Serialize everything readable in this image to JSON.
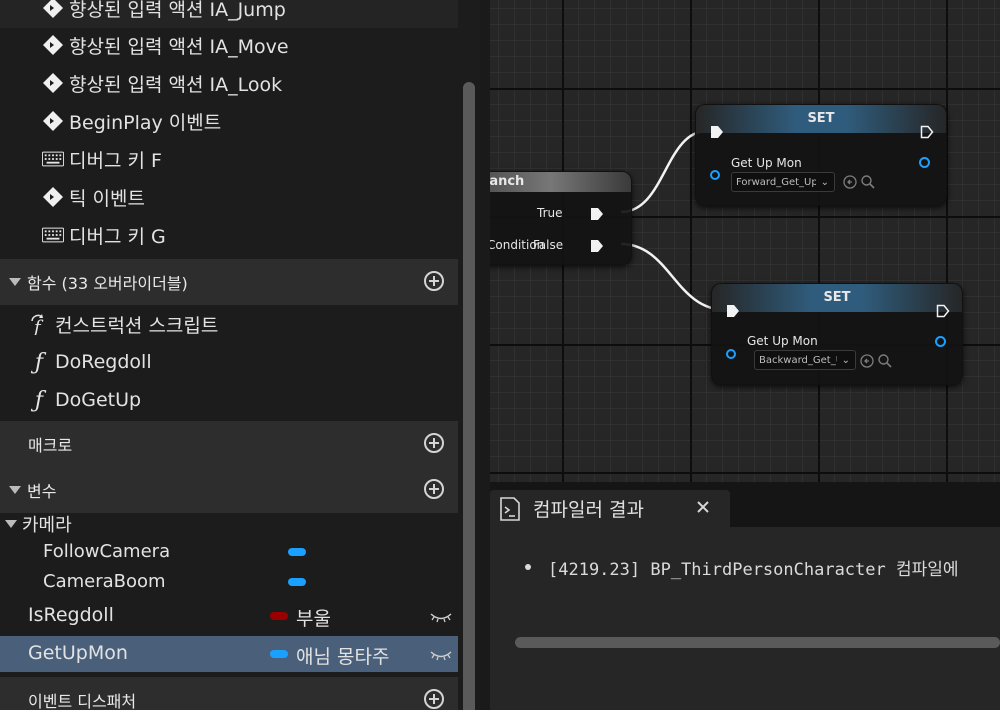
{
  "tree_items": {
    "ia_jump": "향상된 입력 액션 IA_Jump",
    "ia_move": "향상된 입력 액션 IA_Move",
    "ia_look": "향상된 입력 액션 IA_Look",
    "begin_play": "BeginPlay 이벤트",
    "debug_f": "디버그 키 F",
    "tick": "틱 이벤트",
    "debug_g": "디버그 키 G"
  },
  "sections": {
    "functions": "함수 (33 오버라이더블)",
    "macros": "매크로",
    "variables": "변수",
    "event_dispatchers": "이벤트 디스패처"
  },
  "functions": {
    "construction": "컨스트럭션 스크립트",
    "doregdoll": "DoRegdoll",
    "dogetup": "DoGetUp"
  },
  "variables": {
    "category_camera": "카메라",
    "follow_camera": "FollowCamera",
    "camera_boom": "CameraBoom",
    "isregdoll": "IsRegdoll",
    "isregdoll_type": "부울",
    "getupmon": "GetUpMon",
    "getupmon_type": "애님 몽타주"
  },
  "colors": {
    "object_type": "#1aa0ff",
    "bool_type": "#9a0000",
    "selected_row": "#4a5f7a",
    "set_header": "#2f5c7c"
  },
  "graph": {
    "branch": {
      "title": "Branch",
      "condition": "Condition",
      "true_label": "True",
      "false_label": "False"
    },
    "set_node_1": {
      "title": "SET",
      "var_label": "Get Up Mon",
      "value": "Forward_Get_Up"
    },
    "set_node_2": {
      "title": "SET",
      "var_label": "Get Up Mon",
      "value": "Backward_Get_Up"
    }
  },
  "compiler": {
    "tab_title": "컴파일러 결과",
    "log": "[4219.23] BP_ThirdPersonCharacter 컴파일에"
  }
}
